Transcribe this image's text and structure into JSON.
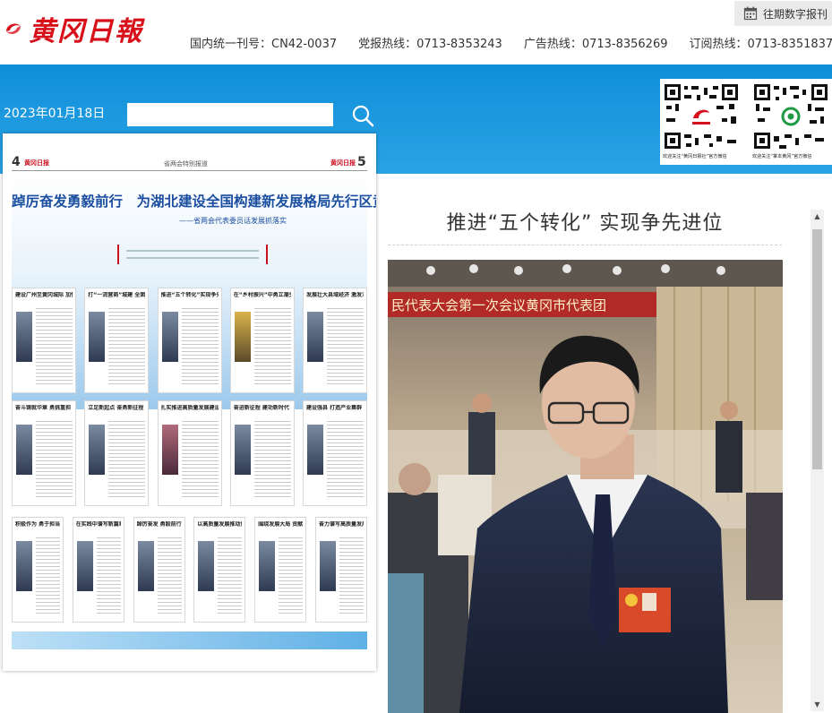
{
  "header": {
    "logo_text": "黄冈日報",
    "archive_label": "往期数字报刊",
    "info": [
      "国内统一刊号：CN42-0037",
      "党报热线：0713-8353243",
      "广告热线：0713-8356269",
      "订阅热线：0713-8351837"
    ]
  },
  "toolbar": {
    "date": "2023年01月18日",
    "search_value": "",
    "search_placeholder": ""
  },
  "qr": {
    "captions": [
      "欢迎关注“黄冈日报社”官方微信",
      "欢迎关注“掌本黄冈”官方微信"
    ]
  },
  "newspaper": {
    "page_left": "4",
    "page_right": "5",
    "masthead": "黄冈日报",
    "section": "省两会特别报道",
    "headline": "踔厉奋发勇毅前行　为湖北建设全国构建新发展格局先行区贡献黄冈力量",
    "subheadline": "——省两会代表委员话发展抓落实",
    "row1": [
      "建设广州至黄冈城际 加快主城崛起",
      "打“一流营商”城建 全面优化营商环境",
      "推进“五个转化”实现争先进位",
      "在“乡村振兴”中勇立潮头",
      "发展壮大县域经济 激发活力"
    ],
    "row2": [
      "奋斗铸就华章 勇挑重担",
      "立足新起点 奋勇新征程",
      "扎实推进高质量发展建设产业集群",
      "奋进新征程 建功新时代",
      "建设强县 打造产业集群"
    ],
    "row3": [
      "积极作为 勇于担当",
      "在实践中谱写新篇章",
      "踔厉奋发 勇毅前行",
      "以高质量发展推动黄冈建设",
      "围绕发展大局 贡献智慧",
      "奋力谱写高质量发展篇章"
    ]
  },
  "article": {
    "title": "推进“五个转化” 实现争先进位",
    "photo_banner": "民代表大会第一次会议黄冈市代表团"
  }
}
